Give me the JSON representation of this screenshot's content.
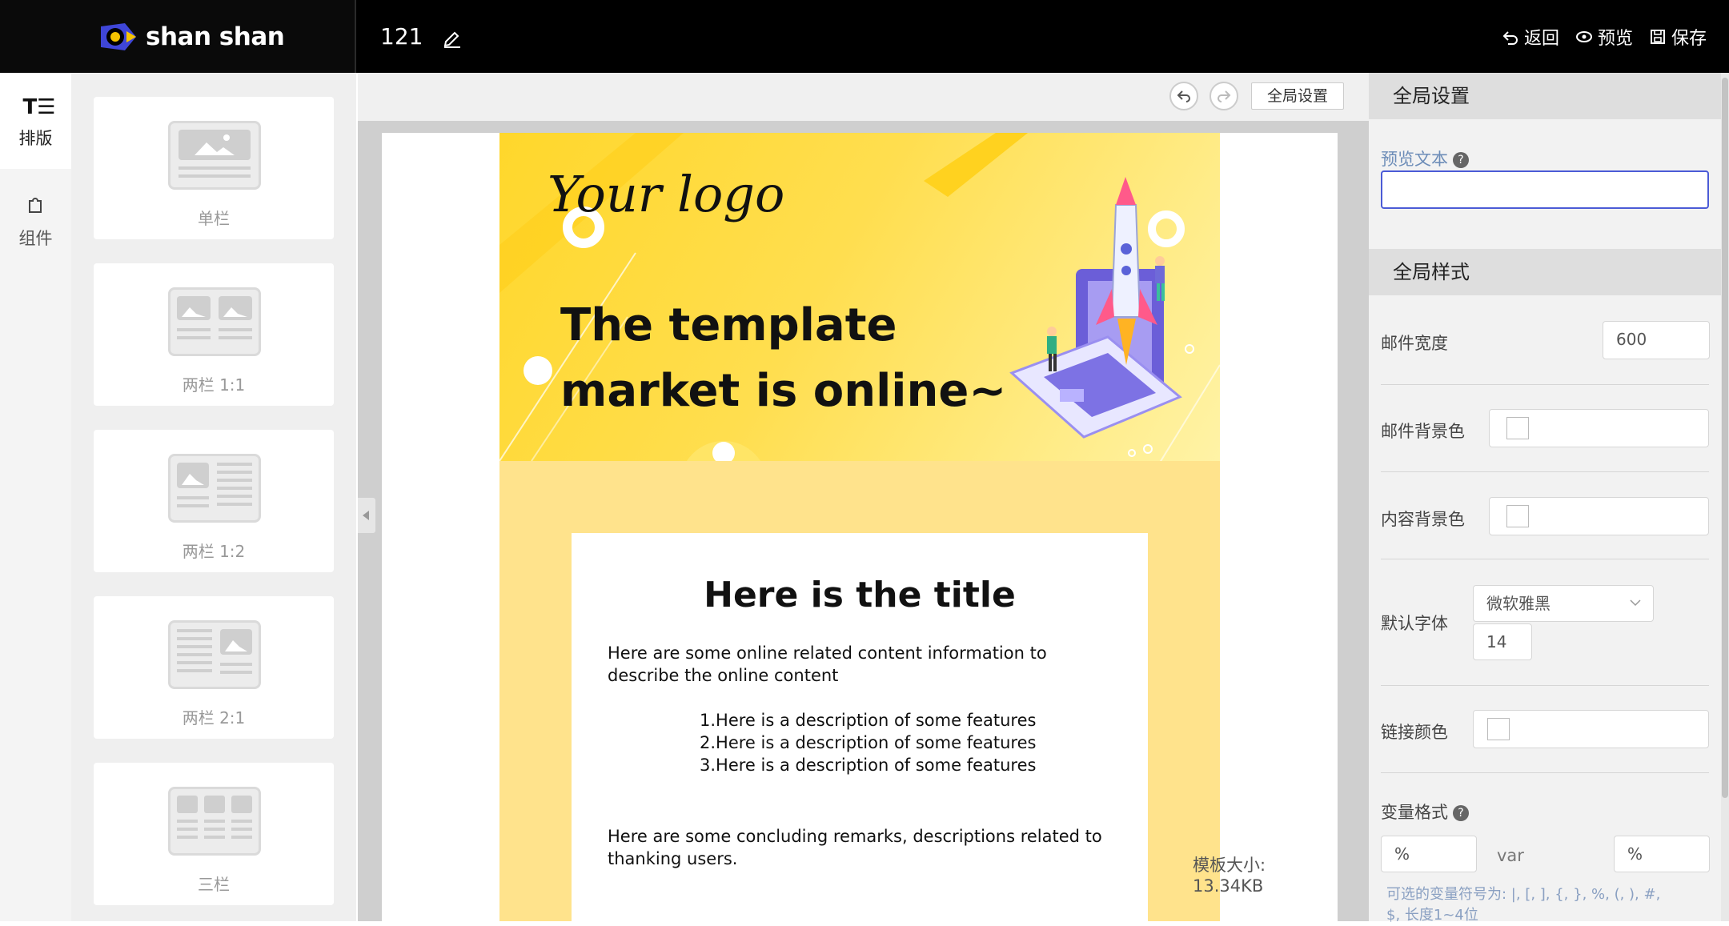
{
  "app": {
    "logo_text": "shan shan",
    "doc_name": "121"
  },
  "topbar": {
    "back_label": "返回",
    "preview_label": "预览",
    "save_label": "保存"
  },
  "leftnav": {
    "layout_label": "排版",
    "components_label": "组件",
    "layout_icon_text": "T☰"
  },
  "blocks": [
    {
      "label": "单栏"
    },
    {
      "label": "两栏 1:1"
    },
    {
      "label": "两栏 1:2"
    },
    {
      "label": "两栏 2:1"
    },
    {
      "label": "三栏"
    }
  ],
  "canvas": {
    "global_settings_button": "全局设置",
    "size_note": "模板大小: 13.34KB"
  },
  "email": {
    "logo": "Your logo",
    "headline_line1": "The template",
    "headline_line2": "market is online~",
    "title": "Here is the title",
    "intro": "Here are some online related content information to describe the online content",
    "features": [
      "1.Here is a description of some features",
      "2.Here is a description of some features",
      "3.Here is a description of some features"
    ],
    "closing": "Here are some concluding remarks,  descriptions related to thanking users."
  },
  "panel": {
    "global_settings_header": "全局设置",
    "preview_text_label": "预览文本",
    "preview_text_value": "",
    "global_style_header": "全局样式",
    "mail_width_label": "邮件宽度",
    "mail_width_value": "600",
    "mail_bg_label": "邮件背景色",
    "content_bg_label": "内容背景色",
    "default_font_label": "默认字体",
    "default_font_value": "微软雅黑",
    "font_size_value": "14",
    "link_color_label": "链接颜色",
    "variable_format_label": "变量格式",
    "var_prefix": "%",
    "var_middle": "var",
    "var_suffix": "%",
    "var_note_line1": "可选的变量符号为: |, [, ], {, }, %, (, ), #,",
    "var_note_line2": "$, 长度1~4位"
  },
  "colors": {
    "accent": "#4b5bd6",
    "banner_yellow": "#ffd72b",
    "email_bg": "#ffe38c"
  }
}
